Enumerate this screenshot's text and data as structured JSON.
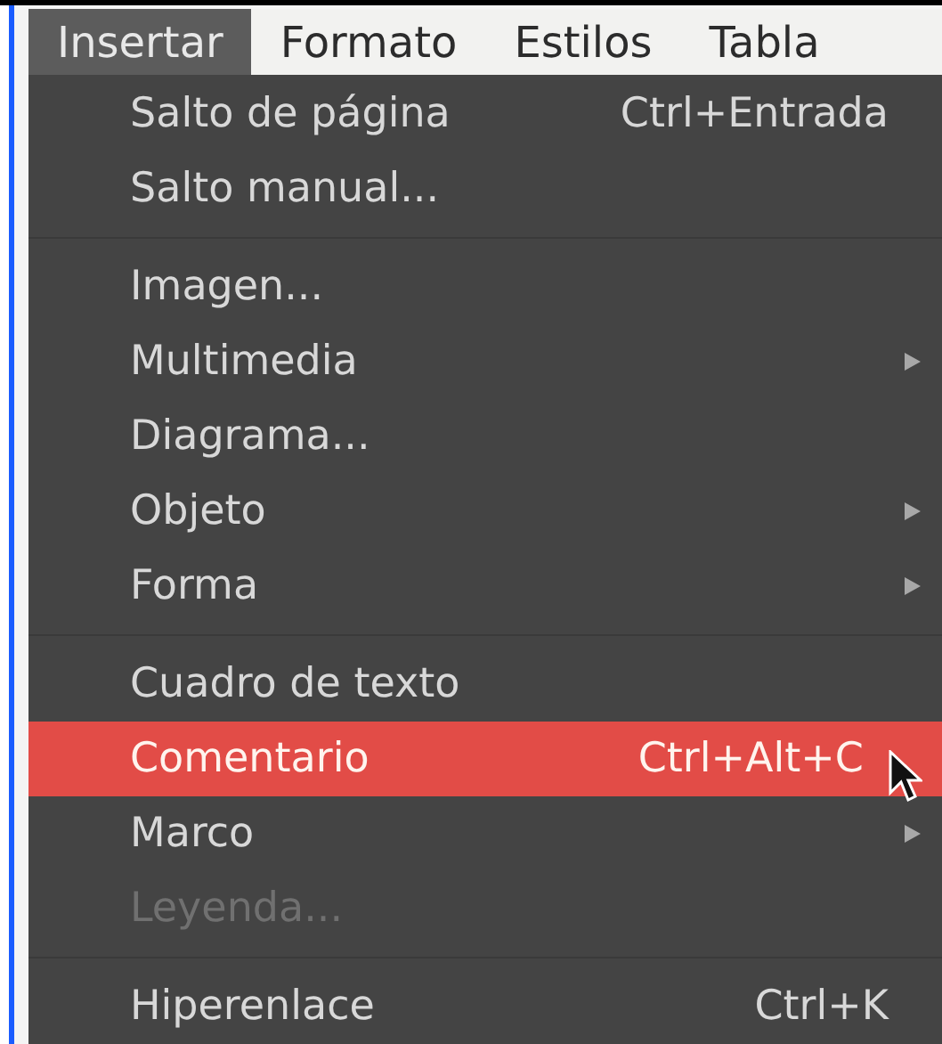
{
  "menubar": [
    {
      "label": "Insertar",
      "selected": true
    },
    {
      "label": "Formato",
      "selected": false
    },
    {
      "label": "Estilos",
      "selected": false
    },
    {
      "label": "Tabla",
      "selected": false
    }
  ],
  "menu": {
    "items": [
      {
        "kind": "item",
        "label": "Salto de página",
        "shortcut": "Ctrl+Entrada",
        "submenu": false,
        "selected": false,
        "disabled": false
      },
      {
        "kind": "item",
        "label": "Salto manual...",
        "submenu": false,
        "selected": false,
        "disabled": false
      },
      {
        "kind": "separator"
      },
      {
        "kind": "item",
        "label": "Imagen...",
        "submenu": false,
        "selected": false,
        "disabled": false
      },
      {
        "kind": "item",
        "label": "Multimedia",
        "submenu": true,
        "selected": false,
        "disabled": false
      },
      {
        "kind": "item",
        "label": "Diagrama...",
        "submenu": false,
        "selected": false,
        "disabled": false
      },
      {
        "kind": "item",
        "label": "Objeto",
        "submenu": true,
        "selected": false,
        "disabled": false
      },
      {
        "kind": "item",
        "label": "Forma",
        "submenu": true,
        "selected": false,
        "disabled": false
      },
      {
        "kind": "separator"
      },
      {
        "kind": "item",
        "label": "Cuadro de texto",
        "submenu": false,
        "selected": false,
        "disabled": false
      },
      {
        "kind": "item",
        "label": "Comentario",
        "shortcut": "Ctrl+Alt+C",
        "submenu": false,
        "selected": true,
        "disabled": false
      },
      {
        "kind": "item",
        "label": "Marco",
        "submenu": true,
        "selected": false,
        "disabled": false
      },
      {
        "kind": "item",
        "label": "Leyenda...",
        "submenu": false,
        "selected": false,
        "disabled": true
      },
      {
        "kind": "separator"
      },
      {
        "kind": "item",
        "label": "Hiperenlace",
        "shortcut": "Ctrl+K",
        "submenu": false,
        "selected": false,
        "disabled": false
      }
    ]
  }
}
